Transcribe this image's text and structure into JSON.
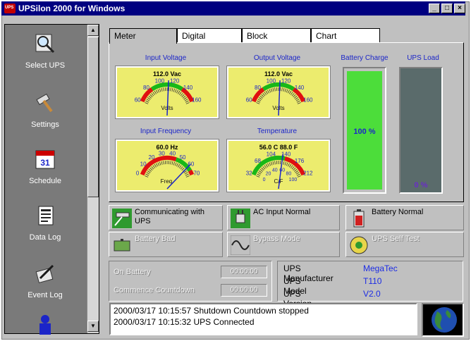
{
  "window": {
    "title": "UPSilon 2000 for Windows",
    "controls": [
      "_",
      "□",
      "×"
    ]
  },
  "sidebar": {
    "items": [
      {
        "label": "Select UPS",
        "icon": "magnifier-icon"
      },
      {
        "label": "Settings",
        "icon": "hammer-icon"
      },
      {
        "label": "Schedule",
        "icon": "calendar-icon",
        "day": "31"
      },
      {
        "label": "Data Log",
        "icon": "document-icon"
      },
      {
        "label": "Event Log",
        "icon": "pen-notepad-icon"
      },
      {
        "label": "",
        "icon": "person-icon"
      }
    ]
  },
  "tabs": [
    "Meter",
    "Digital",
    "Block",
    "Chart"
  ],
  "active_tab": "Meter",
  "meters": {
    "input_voltage": {
      "label": "Input Voltage",
      "reading": "112.0 Vac",
      "unit": "Volts",
      "ticks": [
        "60",
        "80",
        "100",
        "120",
        "140",
        "160"
      ],
      "value": 112
    },
    "output_voltage": {
      "label": "Output Voltage",
      "reading": "112.0 Vac",
      "unit": "Volts",
      "ticks": [
        "60",
        "80",
        "100",
        "120",
        "140",
        "160"
      ],
      "value": 112
    },
    "input_frequency": {
      "label": "Input Frequency",
      "reading": "60.0 Hz",
      "unit": "Freq.",
      "ticks": [
        "0",
        "10",
        "20",
        "30",
        "40",
        "50",
        "60",
        "70"
      ],
      "value": 60
    },
    "temperature": {
      "label": "Temperature",
      "reading": "56.0 C  88.0 F",
      "unit": "C/F",
      "ticks_f": [
        "32",
        "68",
        "104",
        "140",
        "176",
        "212"
      ],
      "ticks_c": [
        "0",
        "20",
        "40",
        "60",
        "80",
        "100"
      ],
      "value_c": 56
    }
  },
  "battery_charge": {
    "label": "Battery Charge",
    "value_text": "100 %",
    "fraction": 1.0,
    "color": "#4cdd3a"
  },
  "ups_load": {
    "label": "UPS Load",
    "value_text": "0 %",
    "fraction": 0.0,
    "color": "#5a6b6b"
  },
  "status": {
    "communicating": {
      "text": "Communicating with UPS",
      "enabled": true
    },
    "ac_input": {
      "text": "AC Input Normal",
      "enabled": true
    },
    "battery_normal": {
      "text": "Battery Normal",
      "enabled": true
    },
    "battery_bad": {
      "text": "Battery Bad",
      "enabled": false
    },
    "bypass_mode": {
      "text": "Bypass Mode",
      "enabled": false
    },
    "self_test": {
      "text": "UPS Self Test",
      "enabled": false
    }
  },
  "timers": {
    "on_battery": {
      "label": "On Battery",
      "value": "00:00:00"
    },
    "countdown": {
      "label": "Commence Countdown",
      "value": "00:00:00"
    }
  },
  "ups_info": {
    "manufacturer": {
      "label": "UPS Manufacturer",
      "value": "MegaTec"
    },
    "model": {
      "label": "UPS Model",
      "value": "T110"
    },
    "version": {
      "label": "UPS Version",
      "value": "V2.0"
    }
  },
  "log_lines": [
    "2000/03/17 10:15:57  Shutdown Countdown stopped",
    "2000/03/17 10:15:32  UPS Connected"
  ],
  "colors": {
    "titlebar": "#000080",
    "accent_blue": "#1b25c8",
    "meter_face": "#ecec6e",
    "red_zone": "#e01010",
    "green_zone": "#18b818"
  }
}
